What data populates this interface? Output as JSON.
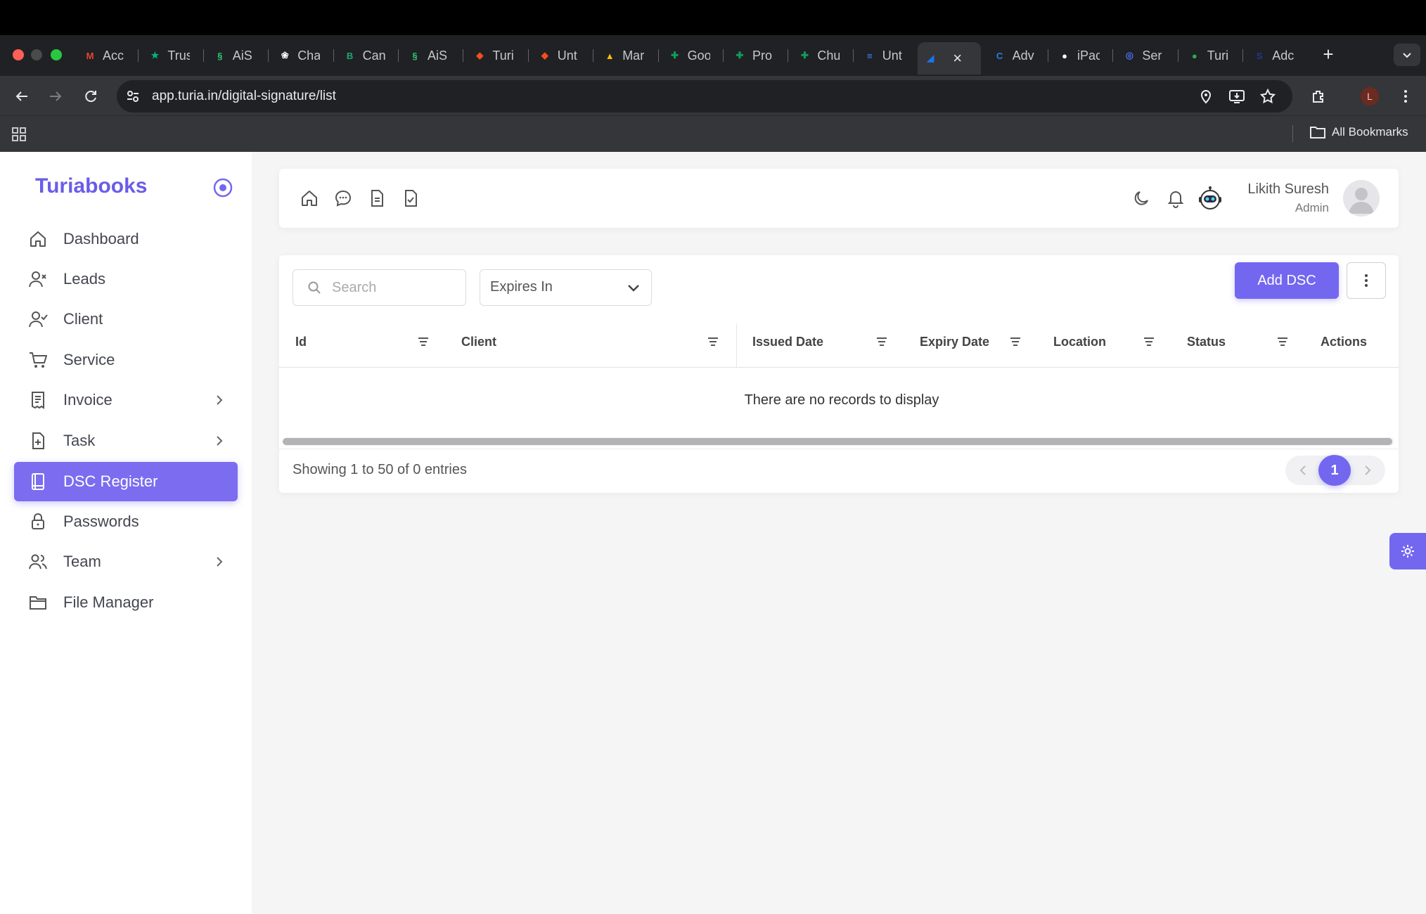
{
  "browser": {
    "tabs": [
      {
        "label": "Acc",
        "favicon": "gmail-icon",
        "color": "#ea4335"
      },
      {
        "label": "Trus",
        "favicon": "star-icon",
        "color": "#00b67a"
      },
      {
        "label": "AiS",
        "favicon": "leaf-icon",
        "color": "#2ecc71"
      },
      {
        "label": "Cha",
        "favicon": "openai-icon",
        "color": "#ffffff"
      },
      {
        "label": "Can",
        "favicon": "b-icon",
        "color": "#1ea672"
      },
      {
        "label": "AiS",
        "favicon": "leaf-icon",
        "color": "#2ecc71"
      },
      {
        "label": "Turi",
        "favicon": "figma-icon",
        "color": "#f24e1e"
      },
      {
        "label": "Unt",
        "favicon": "figma-icon",
        "color": "#f24e1e"
      },
      {
        "label": "Mar",
        "favicon": "drive-icon",
        "color": "#fbbc04"
      },
      {
        "label": "Goo",
        "favicon": "sheets-icon",
        "color": "#0f9d58"
      },
      {
        "label": "Pro",
        "favicon": "sheets-icon",
        "color": "#0f9d58"
      },
      {
        "label": "Chu",
        "favicon": "sheets-icon",
        "color": "#0f9d58"
      },
      {
        "label": "Unt",
        "favicon": "docs-icon",
        "color": "#4285f4"
      },
      {
        "label": "",
        "favicon": "wave-icon",
        "color": "#1a73e8",
        "active": true
      },
      {
        "label": "Adv",
        "favicon": "c-icon",
        "color": "#2b7de9"
      },
      {
        "label": "iPac",
        "favicon": "circle-icon",
        "color": "#ffffff"
      },
      {
        "label": "Ser",
        "favicon": "messenger-icon",
        "color": "#4a6cf7"
      },
      {
        "label": "Turi",
        "favicon": "maps-icon",
        "color": "#34a853"
      },
      {
        "label": "Adc",
        "favicon": "s-icon",
        "color": "#1f3b8c"
      }
    ],
    "url": "app.turia.in/digital-signature/list",
    "bookmarks_label": "All Bookmarks",
    "profile_initial": "L"
  },
  "sidebar": {
    "brand": "Turiabooks",
    "items": [
      {
        "label": "Dashboard",
        "icon": "home-icon"
      },
      {
        "label": "Leads",
        "icon": "user-x-icon"
      },
      {
        "label": "Client",
        "icon": "user-check-icon"
      },
      {
        "label": "Service",
        "icon": "cart-icon"
      },
      {
        "label": "Invoice",
        "icon": "invoice-icon",
        "chevron": true
      },
      {
        "label": "Task",
        "icon": "file-plus-icon",
        "chevron": true
      },
      {
        "label": "DSC Register",
        "icon": "book-icon",
        "active": true
      },
      {
        "label": "Passwords",
        "icon": "lock-icon"
      },
      {
        "label": "Team",
        "icon": "users-icon",
        "chevron": true
      },
      {
        "label": "File Manager",
        "icon": "folder-icon"
      }
    ]
  },
  "header": {
    "user_name": "Likith Suresh",
    "user_role": "Admin"
  },
  "toolbar": {
    "search_placeholder": "Search",
    "filter_value": "Expires In",
    "add_label": "Add DSC"
  },
  "table": {
    "columns": [
      "Id",
      "Client",
      "Issued Date",
      "Expiry Date",
      "Location",
      "Status",
      "Actions"
    ],
    "empty_message": "There are no records to display",
    "showing": "Showing 1 to 50 of 0 entries",
    "current_page": "1"
  },
  "colors": {
    "accent": "#7367f0",
    "brand": "#6a5ce8"
  }
}
